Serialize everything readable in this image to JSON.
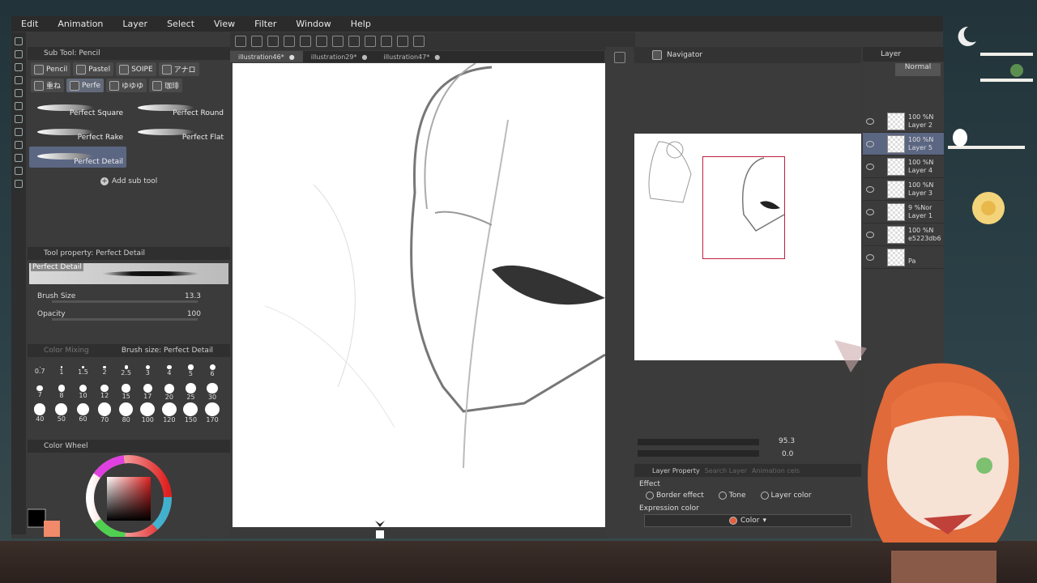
{
  "menu": [
    "Edit",
    "Animation",
    "Layer",
    "Select",
    "View",
    "Filter",
    "Window",
    "Help"
  ],
  "subtool": {
    "header": "Sub Tool: Pencil",
    "tabs": [
      "Pencil",
      "Pastel",
      "SOIPE",
      "アナロ",
      "重ね",
      "Perfe",
      "ゆゆゆ",
      "珈琲"
    ],
    "brushes": [
      "Perfect Square",
      "Perfect Round",
      "Perfect Rake",
      "Perfect Flat",
      "Perfect Detail"
    ],
    "add_label": "Add sub tool"
  },
  "toolprop": {
    "header": "Tool property: Perfect Detail",
    "preview_label": "Perfect Detail",
    "brush_size_label": "Brush Size",
    "brush_size_val": "13.3",
    "opacity_label": "Opacity",
    "opacity_val": "100"
  },
  "brushsize": {
    "tab1": "Color Mixing",
    "tab2": "Brush size: Perfect Detail",
    "sizes": [
      "0.7",
      "1",
      "1.5",
      "2",
      "2.5",
      "3",
      "4",
      "5",
      "6",
      "7",
      "8",
      "10",
      "12",
      "15",
      "17",
      "20",
      "25",
      "30",
      "40",
      "50",
      "60",
      "70",
      "80",
      "100",
      "120",
      "150",
      "170"
    ]
  },
  "colorwheel": {
    "header": "Color Wheel"
  },
  "docs": [
    "illustration46*",
    "illustration29*",
    "illustration47*"
  ],
  "navigator": {
    "title": "Navigator",
    "zoom": "95.3",
    "rotate": "0.0"
  },
  "layerprop": {
    "tabs": [
      "Layer Property",
      "Search Layer",
      "Animation cels"
    ],
    "effect_label": "Effect",
    "border_effect": "Border effect",
    "tone": "Tone",
    "layer_color": "Layer color",
    "expression_label": "Expression color",
    "expression_value": "Color"
  },
  "layers": {
    "title": "Layer",
    "blend": "Normal",
    "rows": [
      {
        "pct": "100 %N",
        "name": "Layer 2"
      },
      {
        "pct": "100 %N",
        "name": "Layer 5"
      },
      {
        "pct": "100 %N",
        "name": "Layer 4"
      },
      {
        "pct": "100 %N",
        "name": "Layer 3"
      },
      {
        "pct": "9 %Nor",
        "name": "Layer 1"
      },
      {
        "pct": "100 %N",
        "name": "e5223db6"
      },
      {
        "pct": "",
        "name": "Pa"
      }
    ]
  }
}
